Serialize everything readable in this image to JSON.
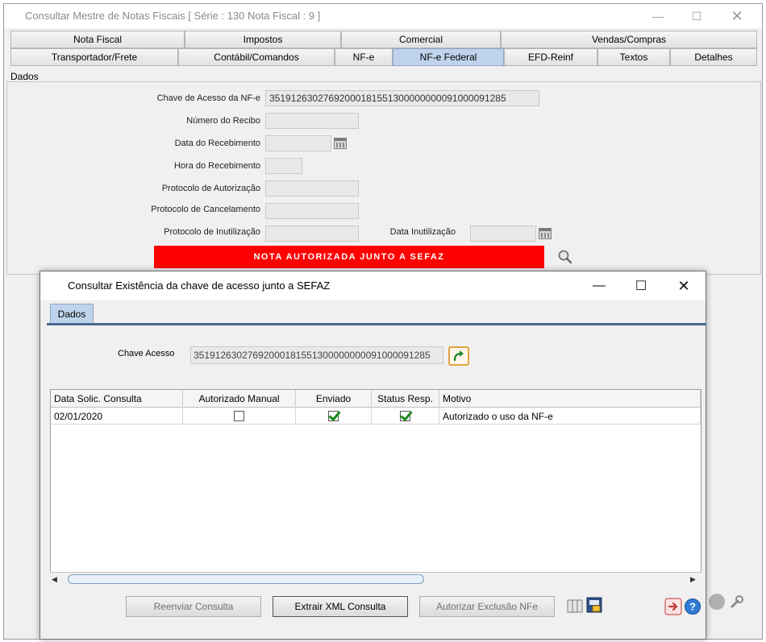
{
  "main": {
    "title": "Consultar Mestre de Notas Fiscais [ Série : 130 Nota Fiscal : 9 ]",
    "tabs_row1": [
      "Nota Fiscal",
      "Impostos",
      "Comercial",
      "Vendas/Compras"
    ],
    "tabs_row2": [
      "Transportador/Frete",
      "Contábil/Comandos",
      "NF-e",
      "NF-e Federal",
      "EFD-Reinf",
      "Textos",
      "Detalhes"
    ],
    "active_tab": "NF-e Federal",
    "panel_title": "Dados",
    "fields": {
      "chave_label": "Chave de Acesso da NF-e",
      "chave_value": "35191263027692000181551300000000091000091285",
      "recibo_label": "Número do Recibo",
      "data_receb_label": "Data do Recebimento",
      "hora_receb_label": "Hora do Recebimento",
      "prot_aut_label": "Protocolo de Autorização",
      "prot_canc_label": "Protocolo de Cancelamento",
      "prot_inut_label": "Protocolo de Inutilização",
      "data_inut_label": "Data Inutilização"
    },
    "status_banner": "NOTA AUTORIZADA JUNTO A SEFAZ"
  },
  "modal": {
    "title": "Consultar Existência da chave de acesso junto a SEFAZ",
    "tab": "Dados",
    "chave_label": "Chave Acesso",
    "chave_value": "35191263027692000181551300000000091000091285",
    "grid": {
      "headers": [
        "Data Solic. Consulta",
        "Autorizado Manual",
        "Enviado",
        "Status Resp.",
        "Motivo"
      ],
      "rows": [
        {
          "data": "02/01/2020",
          "autorizado_manual": false,
          "enviado": true,
          "status_resp": true,
          "motivo": "Autorizado o uso da NF-e"
        }
      ]
    },
    "buttons": {
      "reenviar": "Reenviar Consulta",
      "extrair": "Extrair XML Consulta",
      "autorizar": "Autorizar Exclusão NFe"
    }
  },
  "colors": {
    "banner_red": "#ff0000",
    "active_tab": "#bfd4ec",
    "check_green": "#1a8a1a"
  }
}
